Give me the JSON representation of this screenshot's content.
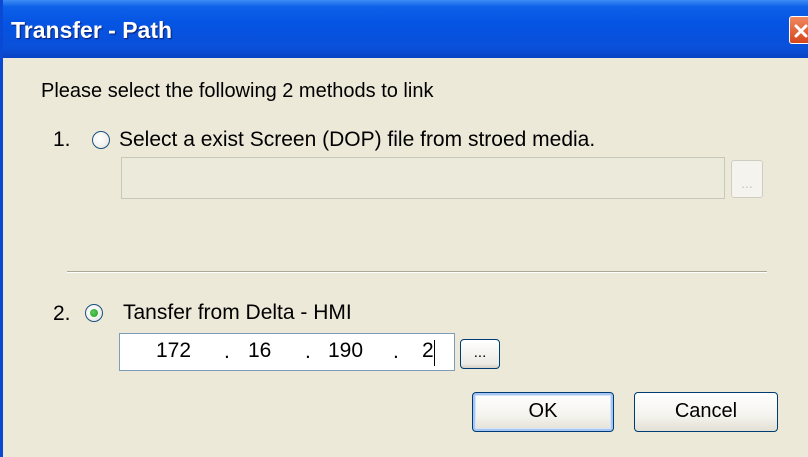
{
  "window": {
    "title": "Transfer - Path"
  },
  "instruction": "Please select the following 2 methods to link",
  "option1": {
    "number": "1.",
    "label": "Select a exist  Screen (DOP) file from stroed media.",
    "selected": false,
    "path_value": "",
    "browse_label": "..."
  },
  "option2": {
    "number": "2.",
    "label": "Tansfer from Delta - HMI",
    "selected": true,
    "ip": {
      "octet1": "172",
      "octet2": "16",
      "octet3": "190",
      "octet4": "2",
      "separator": "."
    },
    "browse_label": "..."
  },
  "buttons": {
    "ok": "OK",
    "cancel": "Cancel"
  },
  "colors": {
    "titlebar": "#0554e3",
    "dialog_bg": "#ece9d8",
    "radio_selected_dot": "#21a121",
    "close_button": "#d6451c"
  }
}
